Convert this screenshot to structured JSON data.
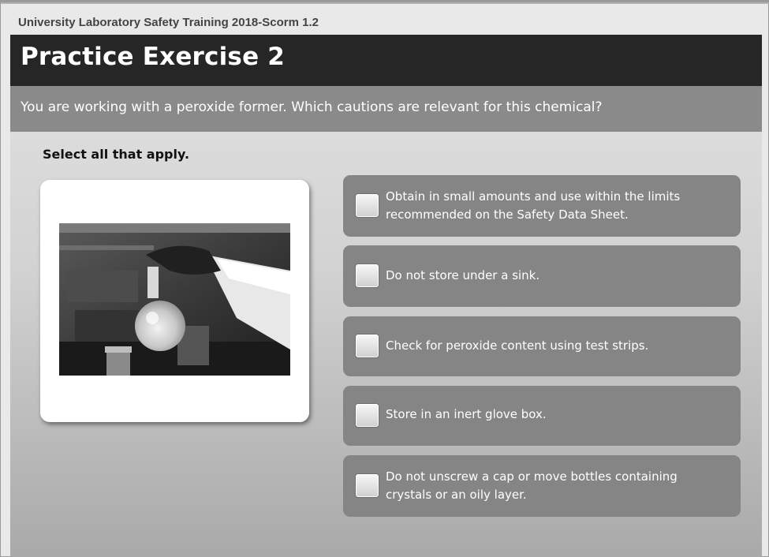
{
  "course": {
    "title": "University Laboratory Safety Training 2018-Scorm 1.2"
  },
  "header": {
    "title": "Practice Exercise 2"
  },
  "question": {
    "text": "You are working with a peroxide former. Which cautions are relevant for this chemical?"
  },
  "instruction": "Select all that apply.",
  "options": [
    {
      "label": "Obtain in small amounts and use within the limits recommended on the Safety Data Sheet.",
      "checked": false
    },
    {
      "label": "Do not store under a sink.",
      "checked": false
    },
    {
      "label": "Check for peroxide content using test strips.",
      "checked": false
    },
    {
      "label": "Store in an inert glove box.",
      "checked": false
    },
    {
      "label": "Do not unscrew a cap or move bottles containing crystals or an oily layer.",
      "checked": false
    }
  ]
}
